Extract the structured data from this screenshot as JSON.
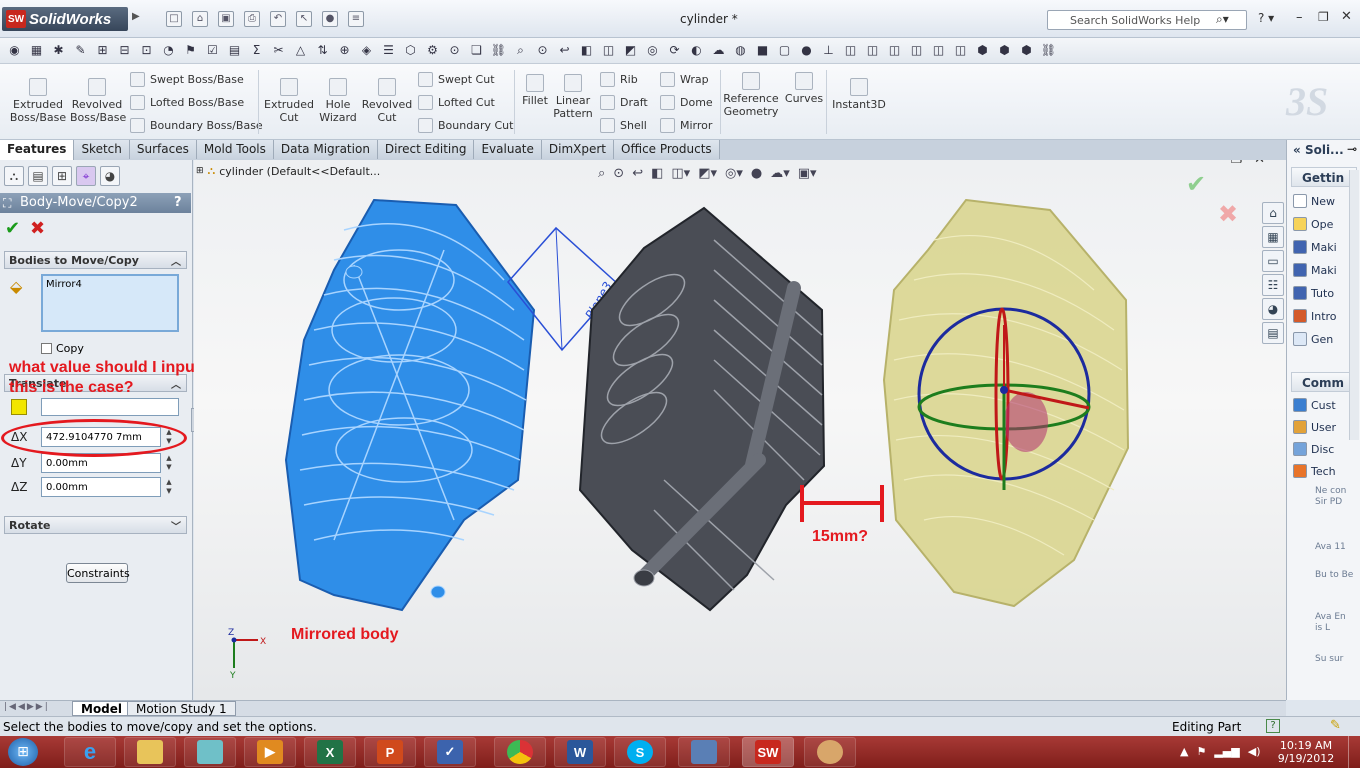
{
  "app": {
    "name": "SolidWorks",
    "logo_letters": "SW",
    "document_title": "cylinder *"
  },
  "help": {
    "placeholder": "Search SolidWorks Help"
  },
  "ribbon": {
    "extruded_boss": "Extruded Boss/Base",
    "revolved_boss": "Revolved Boss/Base",
    "swept_boss": "Swept Boss/Base",
    "lofted_boss": "Lofted Boss/Base",
    "boundary_boss": "Boundary Boss/Base",
    "extruded_cut": "Extruded Cut",
    "hole_wizard": "Hole Wizard",
    "revolved_cut": "Revolved Cut",
    "swept_cut": "Swept Cut",
    "lofted_cut": "Lofted Cut",
    "boundary_cut": "Boundary Cut",
    "fillet": "Fillet",
    "linear_pattern": "Linear Pattern",
    "rib": "Rib",
    "draft": "Draft",
    "shell": "Shell",
    "wrap": "Wrap",
    "dome": "Dome",
    "mirror": "Mirror",
    "reference_geometry": "Reference Geometry",
    "curves": "Curves",
    "instant3d": "Instant3D"
  },
  "tabs": [
    "Features",
    "Sketch",
    "Surfaces",
    "Mold Tools",
    "Data Migration",
    "Direct Editing",
    "Evaluate",
    "DimXpert",
    "Office Products"
  ],
  "tree": {
    "root": "cylinder  (Default<<Default..."
  },
  "property_manager": {
    "title": "Body-Move/Copy2",
    "help": "?",
    "bodies_header": "Bodies to Move/Copy",
    "selected_body": "Mirror4",
    "copy_label": "Copy",
    "translate_header": "Translate",
    "dx_label": "ΔX",
    "dx_value": "472.9104770 7mm",
    "dy_label": "ΔY",
    "dy_value": "0.00mm",
    "dz_label": "ΔZ",
    "dz_value": "0.00mm",
    "rotate_header": "Rotate",
    "constraints_button": "Constraints"
  },
  "annotations": {
    "question": "what value should I input if this is the case?",
    "gap": "15mm?",
    "mirrored": "Mirrored body"
  },
  "viewport": {
    "plane_label": "Plane3",
    "triad_x": "X",
    "triad_y": "Y",
    "triad_z": "Z"
  },
  "taskpane": {
    "title": "Soli...",
    "getting_header": "Gettin",
    "items": [
      "New",
      "Ope",
      "Maki",
      "Maki",
      "Tuto",
      "Intro",
      "Gen"
    ],
    "community_header": "Comm",
    "community_items": [
      "Cust",
      "User",
      "Disc",
      "Tech"
    ],
    "news": [
      "Ne con Sir PD",
      "Ava 11",
      "Bu to Be",
      "Ava En is L",
      "Su sur"
    ]
  },
  "bottom_tabs": {
    "model": "Model",
    "motion": "Motion Study 1"
  },
  "status": {
    "message": "Select the bodies to move/copy and set the options.",
    "mode": "Editing Part"
  },
  "taskbar": {
    "time": "10:19 AM",
    "date": "9/19/2012"
  },
  "colors": {
    "blue_body": "#2f8ee8",
    "gray_body": "#4a4d55",
    "yellow_body": "#d8d48a",
    "annotation": "#e4191f"
  }
}
